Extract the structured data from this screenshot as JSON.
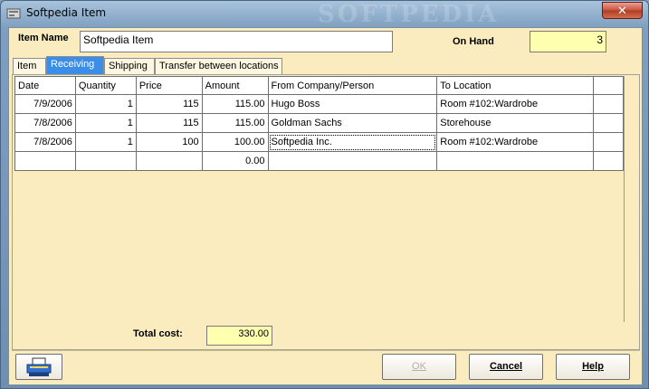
{
  "window": {
    "title": "Softpedia Item",
    "watermark": "SOFTPEDIA",
    "close_label": "✕"
  },
  "form": {
    "item_name_label": "Item Name",
    "item_name_value": "Softpedia Item",
    "on_hand_label": "On Hand",
    "on_hand_value": "3"
  },
  "tabs": [
    {
      "label": "Item",
      "active": false
    },
    {
      "label": "Receiving",
      "active": true
    },
    {
      "label": "Shipping",
      "active": false
    },
    {
      "label": "Transfer between  locations",
      "active": false
    }
  ],
  "grid": {
    "columns": [
      "Date",
      "Quantity",
      "Price",
      "Amount",
      "From Company/Person",
      "To Location",
      ""
    ],
    "rows": [
      [
        "7/9/2006",
        "1",
        "115",
        "115.00",
        "Hugo Boss",
        "Room #102:Wardrobe",
        ""
      ],
      [
        "7/8/2006",
        "1",
        "115",
        "115.00",
        "Goldman Sachs",
        "Storehouse",
        ""
      ],
      [
        "7/8/2006",
        "1",
        "100",
        "100.00",
        "Softpedia Inc.",
        "Room #102:Wardrobe",
        ""
      ],
      [
        "",
        "",
        "",
        "0.00",
        "",
        "",
        ""
      ]
    ]
  },
  "total": {
    "label": "Total cost:",
    "value": "330.00"
  },
  "buttons": {
    "ok": "OK",
    "cancel": "Cancel",
    "help": "Help",
    "print_icon": "printer-icon"
  }
}
